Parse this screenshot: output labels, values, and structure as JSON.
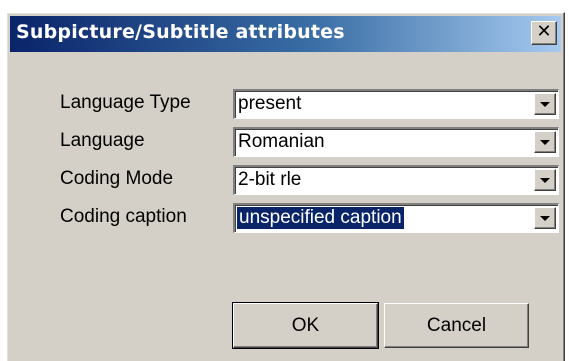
{
  "window": {
    "title": "Subpicture/Subtitle attributes",
    "close_glyph": "✕"
  },
  "fields": [
    {
      "label": "Language Type",
      "value": "present"
    },
    {
      "label": "Language",
      "value": "Romanian"
    },
    {
      "label": "Coding Mode",
      "value": "2-bit rle"
    },
    {
      "label": "Coding caption",
      "value": "unspecified caption"
    }
  ],
  "buttons": {
    "ok": "OK",
    "cancel": "Cancel"
  },
  "icons": {
    "close": "close-icon",
    "dropdown": "chevron-down-icon"
  },
  "colors": {
    "titlebar_start": "#0a246a",
    "titlebar_end": "#a6caf0",
    "face": "#d4d0c8",
    "selection": "#0a246a"
  }
}
